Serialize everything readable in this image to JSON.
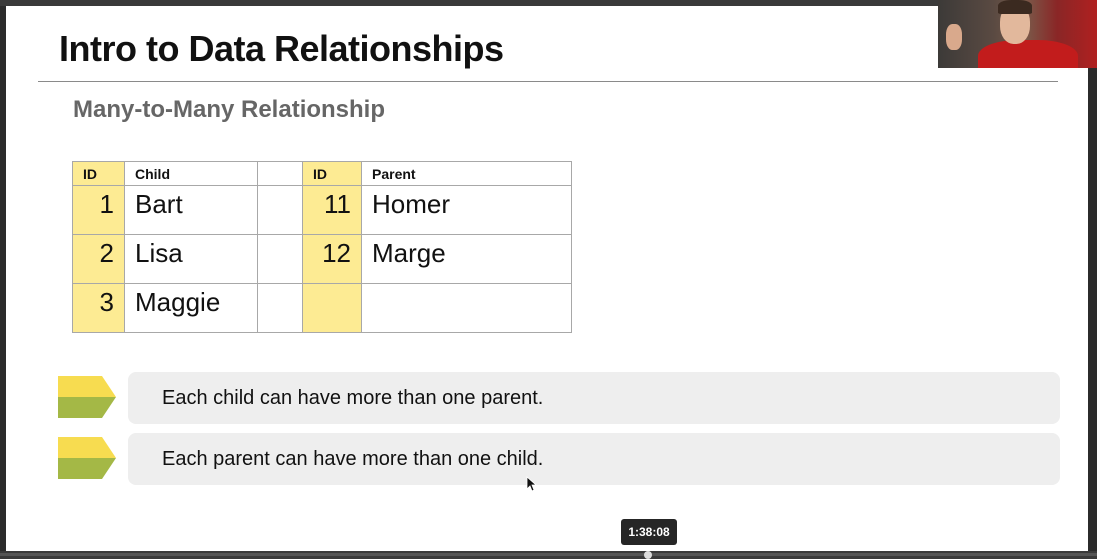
{
  "slide": {
    "title": "Intro to Data Relationships",
    "subtitle": "Many-to-Many Relationship"
  },
  "table": {
    "headers": [
      "ID",
      "Child",
      "",
      "ID",
      "Parent"
    ],
    "rows": [
      {
        "child_id": "1",
        "child": "Bart",
        "parent_id": "11",
        "parent": "Homer"
      },
      {
        "child_id": "2",
        "child": "Lisa",
        "parent_id": "12",
        "parent": "Marge"
      },
      {
        "child_id": "3",
        "child": "Maggie",
        "parent_id": "",
        "parent": ""
      }
    ]
  },
  "bullets": [
    {
      "text": "Each child can have more than one parent."
    },
    {
      "text": "Each parent can have more than one child."
    }
  ],
  "player": {
    "timestamp": "1:38:08"
  },
  "icons": {
    "bullet": "arrow-tag-icon",
    "cursor": "mouse-pointer-icon"
  },
  "colors": {
    "id_column": "#fdeb93",
    "arrow_top": "#f7dc50",
    "arrow_bottom": "#a4b846",
    "bullet_box": "#eeeeee"
  }
}
